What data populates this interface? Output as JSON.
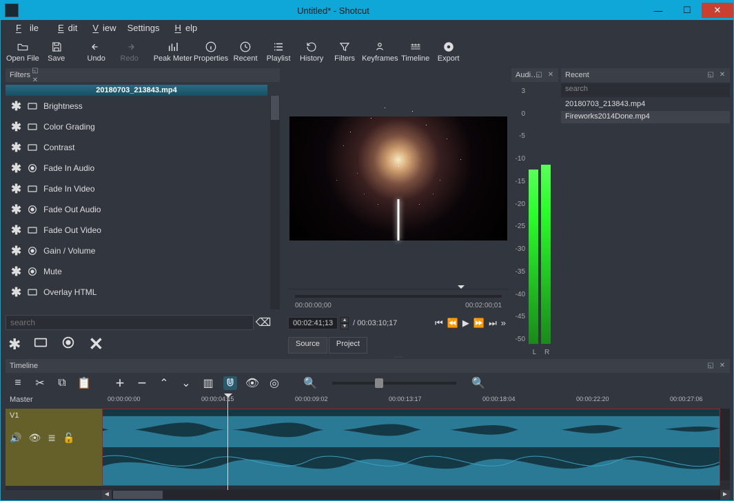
{
  "window": {
    "title": "Untitled* - Shotcut"
  },
  "menu": {
    "file": "File",
    "edit": "Edit",
    "view": "View",
    "settings": "Settings",
    "help": "Help"
  },
  "toolbar": {
    "open": "Open File",
    "save": "Save",
    "undo": "Undo",
    "redo": "Redo",
    "peak": "Peak Meter",
    "properties": "Properties",
    "recent": "Recent",
    "playlist": "Playlist",
    "history": "History",
    "filters": "Filters",
    "keyframes": "Keyframes",
    "timeline": "Timeline",
    "export": "Export"
  },
  "filters": {
    "panel_title": "Filters",
    "clip": "20180703_213843.mp4",
    "items": [
      {
        "label": "Brightness",
        "icon": "monitor"
      },
      {
        "label": "Color Grading",
        "icon": "monitor"
      },
      {
        "label": "Contrast",
        "icon": "monitor"
      },
      {
        "label": "Fade In Audio",
        "icon": "speaker"
      },
      {
        "label": "Fade In Video",
        "icon": "monitor"
      },
      {
        "label": "Fade Out Audio",
        "icon": "speaker"
      },
      {
        "label": "Fade Out Video",
        "icon": "monitor"
      },
      {
        "label": "Gain / Volume",
        "icon": "speaker"
      },
      {
        "label": "Mute",
        "icon": "speaker"
      },
      {
        "label": "Overlay HTML",
        "icon": "monitor"
      }
    ],
    "search_placeholder": "search"
  },
  "preview": {
    "scrub_start": "00:00:00;00",
    "scrub_end": "00:02:00;01",
    "current_tc": "00:02:41;13",
    "duration": "00:03:10;17",
    "tab_source": "Source",
    "tab_project": "Project"
  },
  "audio": {
    "panel_title": "Audi…",
    "scale": [
      "3",
      "0",
      "-5",
      "-10",
      "-15",
      "-20",
      "-25",
      "-30",
      "-35",
      "-40",
      "-45",
      "-50"
    ],
    "L": "L",
    "R": "R",
    "level_l_pct": 68,
    "level_r_pct": 70
  },
  "recent": {
    "panel_title": "Recent",
    "search_placeholder": "search",
    "items": [
      "20180703_213843.mp4",
      "Fireworks2014Done.mp4"
    ],
    "selected_index": 1
  },
  "timeline": {
    "panel_title": "Timeline",
    "master": "Master",
    "track": "V1",
    "ruler": [
      "00:00:00:00",
      "00:00:04:15",
      "00:00:09:02",
      "00:00:13:17",
      "00:00:18:04",
      "00:00:22:20",
      "00:00:27:06"
    ]
  }
}
